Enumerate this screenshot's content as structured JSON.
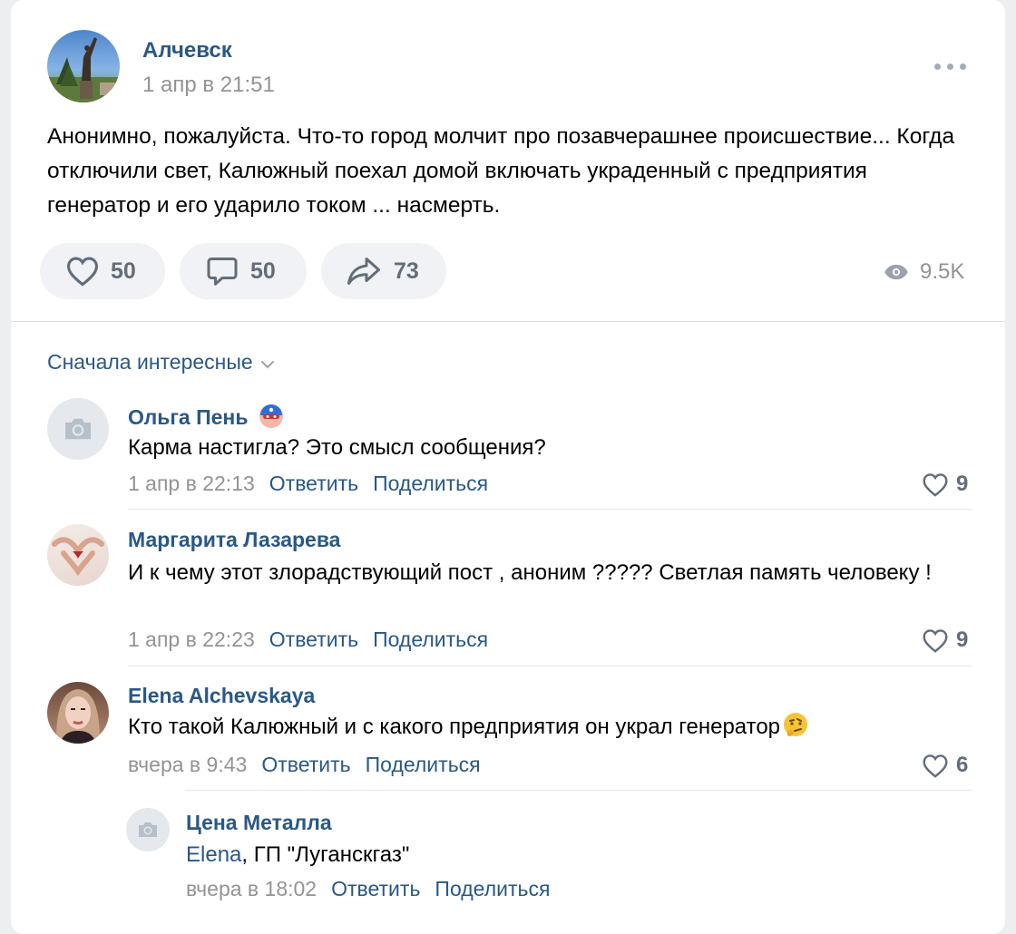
{
  "post": {
    "author": "Алчевск",
    "date": "1 апр в 21:51",
    "text": "Анонимно, пожалуйста. Что-то город молчит про позавчерашнее происшествие... Когда отключили свет, Калюжный поехал домой включать украденный с предприятия генератор и его ударило током ... насмерть.",
    "likes": "50",
    "comments": "50",
    "shares": "73",
    "views": "9.5K"
  },
  "sort": {
    "label": "Сначала интересные"
  },
  "comments": [
    {
      "name": "Ольга Пень",
      "text": "Карма настигла? Это смысл сообщения?",
      "date": "1 апр в 22:13",
      "reply": "Ответить",
      "share": "Поделиться",
      "likes": "9"
    },
    {
      "name": "Маргарита Лазарева",
      "text": "И к чему этот злорадствующий пост , аноним ????? Светлая память человеку !",
      "date": "1 апр в 22:23",
      "reply": "Ответить",
      "share": "Поделиться",
      "likes": "9"
    },
    {
      "name": "Elena Alchevskaya",
      "text": "Кто такой Калюжный и с какого предприятия он украл генератор",
      "emoji": "🤔",
      "date": "вчера в 9:43",
      "reply": "Ответить",
      "share": "Поделиться",
      "likes": "6"
    },
    {
      "name": "Цена Металла",
      "mention": "Elena",
      "text": ", ГП \"Луганскгаз\"",
      "date": "вчера в 18:02",
      "reply": "Ответить",
      "share": "Поделиться"
    }
  ],
  "colors": {
    "link": "#2a5885",
    "muted": "#939393",
    "pill": "#f0f2f5"
  }
}
